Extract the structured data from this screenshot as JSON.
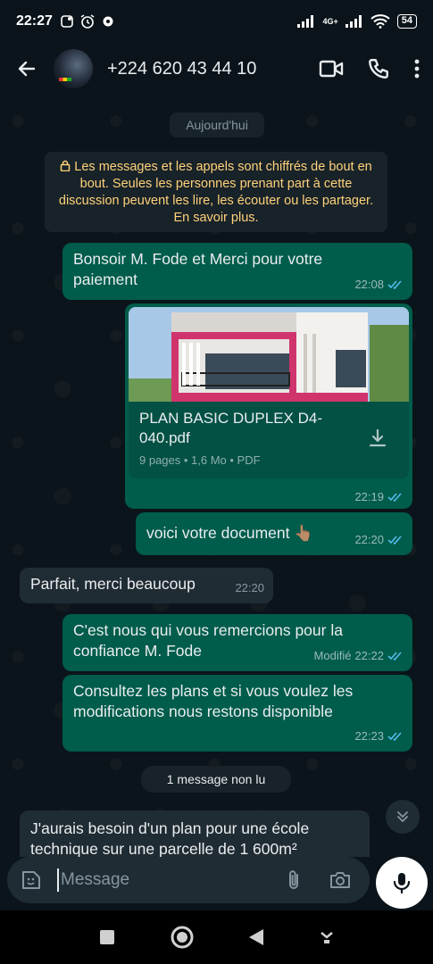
{
  "status_bar": {
    "time": "22:27",
    "network": "4G+",
    "battery": "54"
  },
  "header": {
    "contact_name": "+224 620 43 44 10"
  },
  "chat": {
    "date_chip": "Aujourd'hui",
    "encryption_notice": "Les messages et les appels sont chiffrés de bout en bout. Seules les personnes prenant part à cette discussion peuvent les lire, les écouter ou les partager. En savoir plus.",
    "messages": [
      {
        "text": "Bonsoir M. Fode et Merci pour votre paiement",
        "time": "22:08"
      },
      {
        "text": "voici votre document 👆🏽",
        "time": "22:20"
      },
      {
        "text": "Parfait, merci beaucoup",
        "time": "22:20"
      },
      {
        "text": "C'est nous qui vous remercions pour la confiance M. Fode",
        "edited": "Modifié",
        "time": "22:22"
      },
      {
        "text": "Consultez les plans et si vous voulez les modifications nous restons disponible",
        "time": "22:23"
      },
      {
        "text": "J'aurais besoin d'un plan pour une école technique sur une parcelle de 1 600m²"
      }
    ],
    "document": {
      "name": "PLAN BASIC DUPLEX D4-040.pdf",
      "details": "9 pages • 1,6 Mo • PDF",
      "time": "22:19"
    },
    "unread_chip": "1 message non lu"
  },
  "input": {
    "placeholder": "Message"
  },
  "colors": {
    "outgoing_bubble": "#005c4b",
    "incoming_bubble": "#202c33",
    "read_ticks": "#53bdeb",
    "notice_text": "#ffd279"
  }
}
